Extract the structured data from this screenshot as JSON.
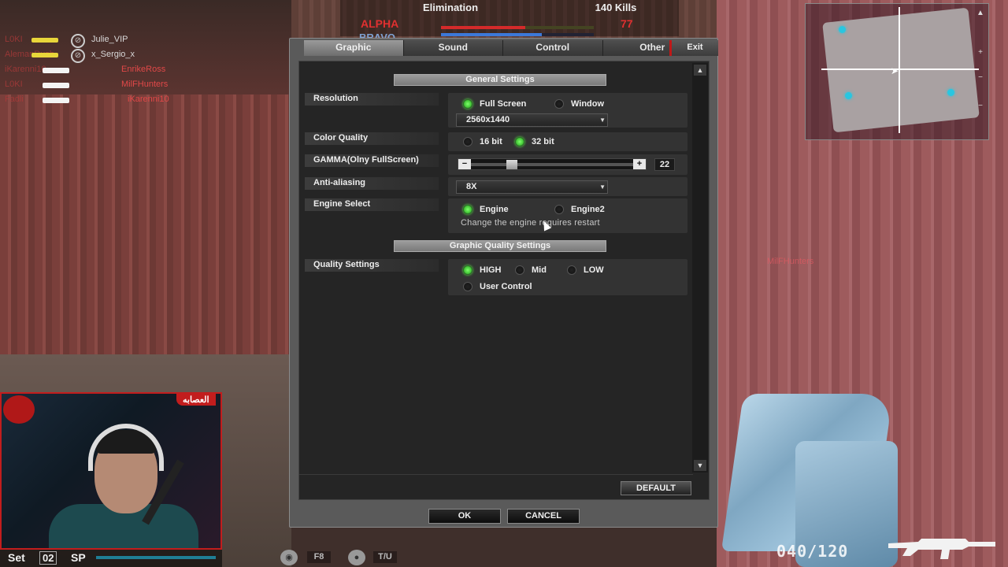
{
  "hud": {
    "mode": "Elimination",
    "kill_limit": "140 Kills",
    "alpha_label": "ALPHA",
    "alpha_score": "77",
    "alpha_progress": 0.55,
    "bravo_label": "BRAVO",
    "bravo_progress": 0.66,
    "ghost_name": "MilFHunters"
  },
  "killfeed": [
    {
      "killer": "L0KI",
      "victim": "Julie_VIP",
      "gun": "yellow",
      "icon": "headshot-icon"
    },
    {
      "killer": "AlemanRush",
      "victim": "x_Sergio_x",
      "gun": "yellow",
      "icon": "headshot-icon"
    },
    {
      "killer": "iKarenni10",
      "victim": "EnrikeRoss",
      "gun": "white",
      "icon": ""
    },
    {
      "killer": "L0KI",
      "victim": "MilFHunters",
      "gun": "white",
      "icon": ""
    },
    {
      "killer": "Fadli",
      "victim": "iKarenni10",
      "gun": "white",
      "icon": ""
    }
  ],
  "dialog": {
    "tabs": [
      {
        "label": "Graphic",
        "active": true
      },
      {
        "label": "Sound",
        "active": false
      },
      {
        "label": "Control",
        "active": false
      },
      {
        "label": "Other",
        "active": false
      }
    ],
    "exit_label": "Exit",
    "general_header": "General Settings",
    "quality_header": "Graphic Quality Settings",
    "resolution": {
      "label": "Resolution",
      "fullscreen": "Full Screen",
      "window": "Window",
      "selected_mode": "Full Screen",
      "value": "2560x1440"
    },
    "color_quality": {
      "label": "Color Quality",
      "opt16": "16 bit",
      "opt32": "32 bit",
      "selected": "32 bit"
    },
    "gamma": {
      "label": "GAMMA(Olny FullScreen)",
      "minus": "−",
      "plus": "+",
      "value": "22",
      "level": 0.22
    },
    "antialiasing": {
      "label": "Anti-aliasing",
      "value": "8X"
    },
    "engine": {
      "label": "Engine Select",
      "opt1": "Engine",
      "opt2": "Engine2",
      "selected": "Engine",
      "note": "Change the engine requires restart"
    },
    "quality": {
      "label": "Quality Settings",
      "high": "HIGH",
      "mid": "Mid",
      "low": "LOW",
      "user": "User Control",
      "selected": "HIGH"
    },
    "default_label": "DEFAULT",
    "ok_label": "OK",
    "cancel_label": "CANCEL"
  },
  "webcam": {
    "tag": "العصابه"
  },
  "bottom_hud": {
    "set_label": "Set",
    "set_number": "02",
    "sp_label": "SP",
    "key1": "F8",
    "key2": "T/U",
    "ammo": "040/120"
  },
  "colors": {
    "radio_on": "#1ea116",
    "alpha": "#e03030",
    "bravo": "#3c78d8",
    "exit_accent": "#c01818"
  }
}
